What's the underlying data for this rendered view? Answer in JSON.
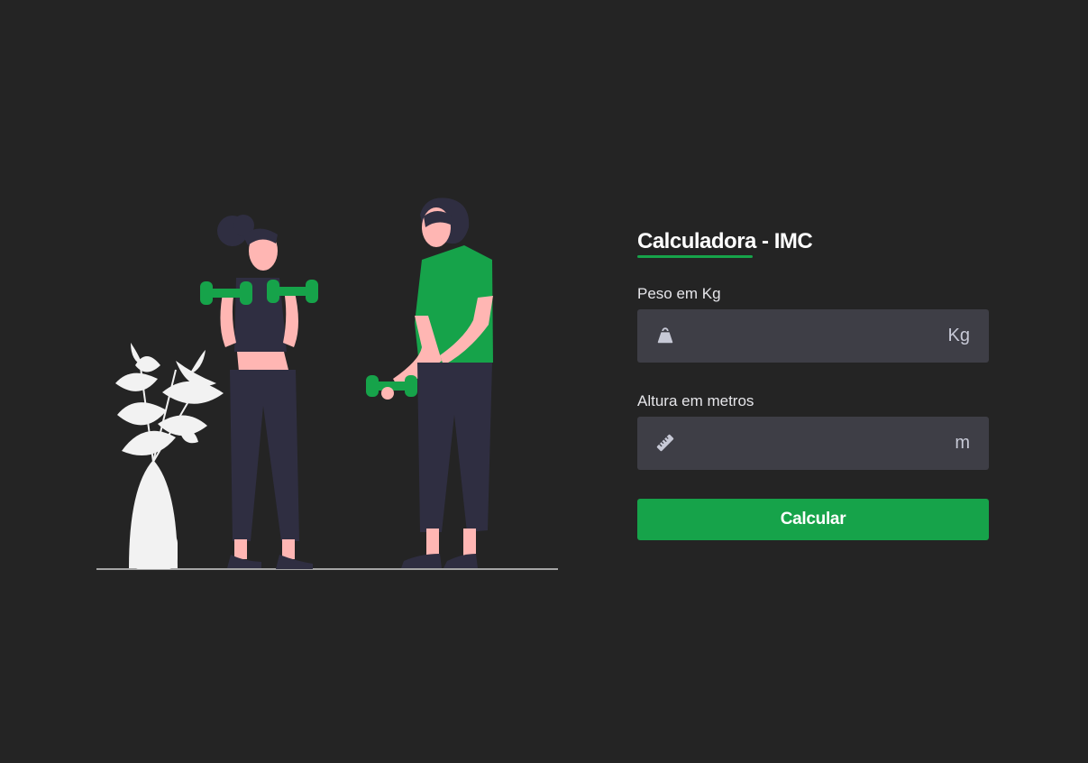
{
  "app": {
    "title": "Calculadora - IMC"
  },
  "form": {
    "weight": {
      "label": "Peso em Kg",
      "value": "",
      "placeholder": "",
      "unit": "Kg",
      "icon": "weight-icon"
    },
    "height": {
      "label": "Altura em metros",
      "value": "",
      "placeholder": "",
      "unit": "m",
      "icon": "ruler-icon"
    },
    "submit_label": "Calcular"
  },
  "colors": {
    "background": "#242424",
    "accent": "#16a34a",
    "input_background": "#3e3e46",
    "skin": "#ffb6b3",
    "clothing_dark": "#2f2e41",
    "plant": "#f2f2f2"
  }
}
